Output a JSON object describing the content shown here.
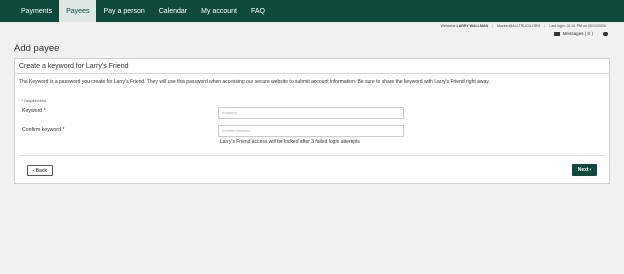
{
  "nav": {
    "tabs": [
      {
        "label": "Payments",
        "active": false
      },
      {
        "label": "Payees",
        "active": true
      },
      {
        "label": "Pay a person",
        "active": false
      },
      {
        "label": "Calendar",
        "active": false
      },
      {
        "label": "My account",
        "active": false
      },
      {
        "label": "FAQ",
        "active": false
      }
    ]
  },
  "header": {
    "welcome_prefix": "Welcome",
    "user_name": "LARRY WALLMAN",
    "user_email": "Mocker@ALLTRUCU.ORG",
    "last_login": "Last login: 01:41 PM on 05/12/2026",
    "messages_label": "Messages ( 0 )"
  },
  "page": {
    "title": "Add payee"
  },
  "panel": {
    "title": "Create a keyword for Larry's Friend",
    "intro": "The Keyword is a password you create for Larry's Friend. They will use this password when accessing our secure website to submit account information. Be sure to share the keyword with Larry's Friend right away.",
    "required_note": "* Required field",
    "keyword_label": "Keyword *",
    "keyword_placeholder": "Keyword",
    "confirm_label": "Confirm keyword *",
    "confirm_placeholder": "Confirm keyword",
    "lock_hint": "Larry's Friend access will be locked after 3 failed login attempts"
  },
  "actions": {
    "back_label": "Back",
    "next_label": "Next"
  },
  "colors": {
    "brand": "#0d4a3c",
    "active_tab_bg": "#dfe8e5",
    "page_bg": "#f1f1f1"
  }
}
